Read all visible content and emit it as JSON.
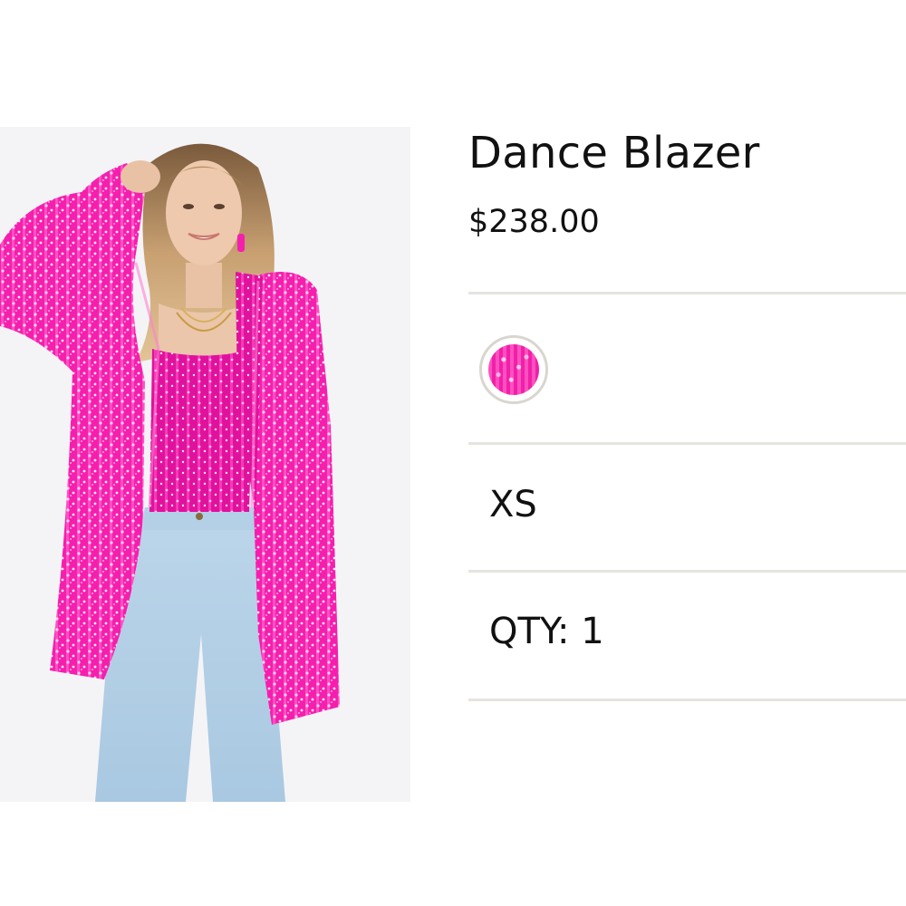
{
  "product": {
    "title": "Dance Blazer",
    "price": "$238.00",
    "image_alt": "Model wearing pink sequin blazer and matching top with light-wash jeans"
  },
  "color_swatch": {
    "colors": {
      "primary": "#f51fae",
      "highlight": "#ff8fdc"
    }
  },
  "size": {
    "selected": "XS"
  },
  "quantity": {
    "label": "QTY: 1"
  },
  "colors": {
    "divider": "#e6e4df",
    "text": "#111111",
    "background": "#ffffff"
  }
}
